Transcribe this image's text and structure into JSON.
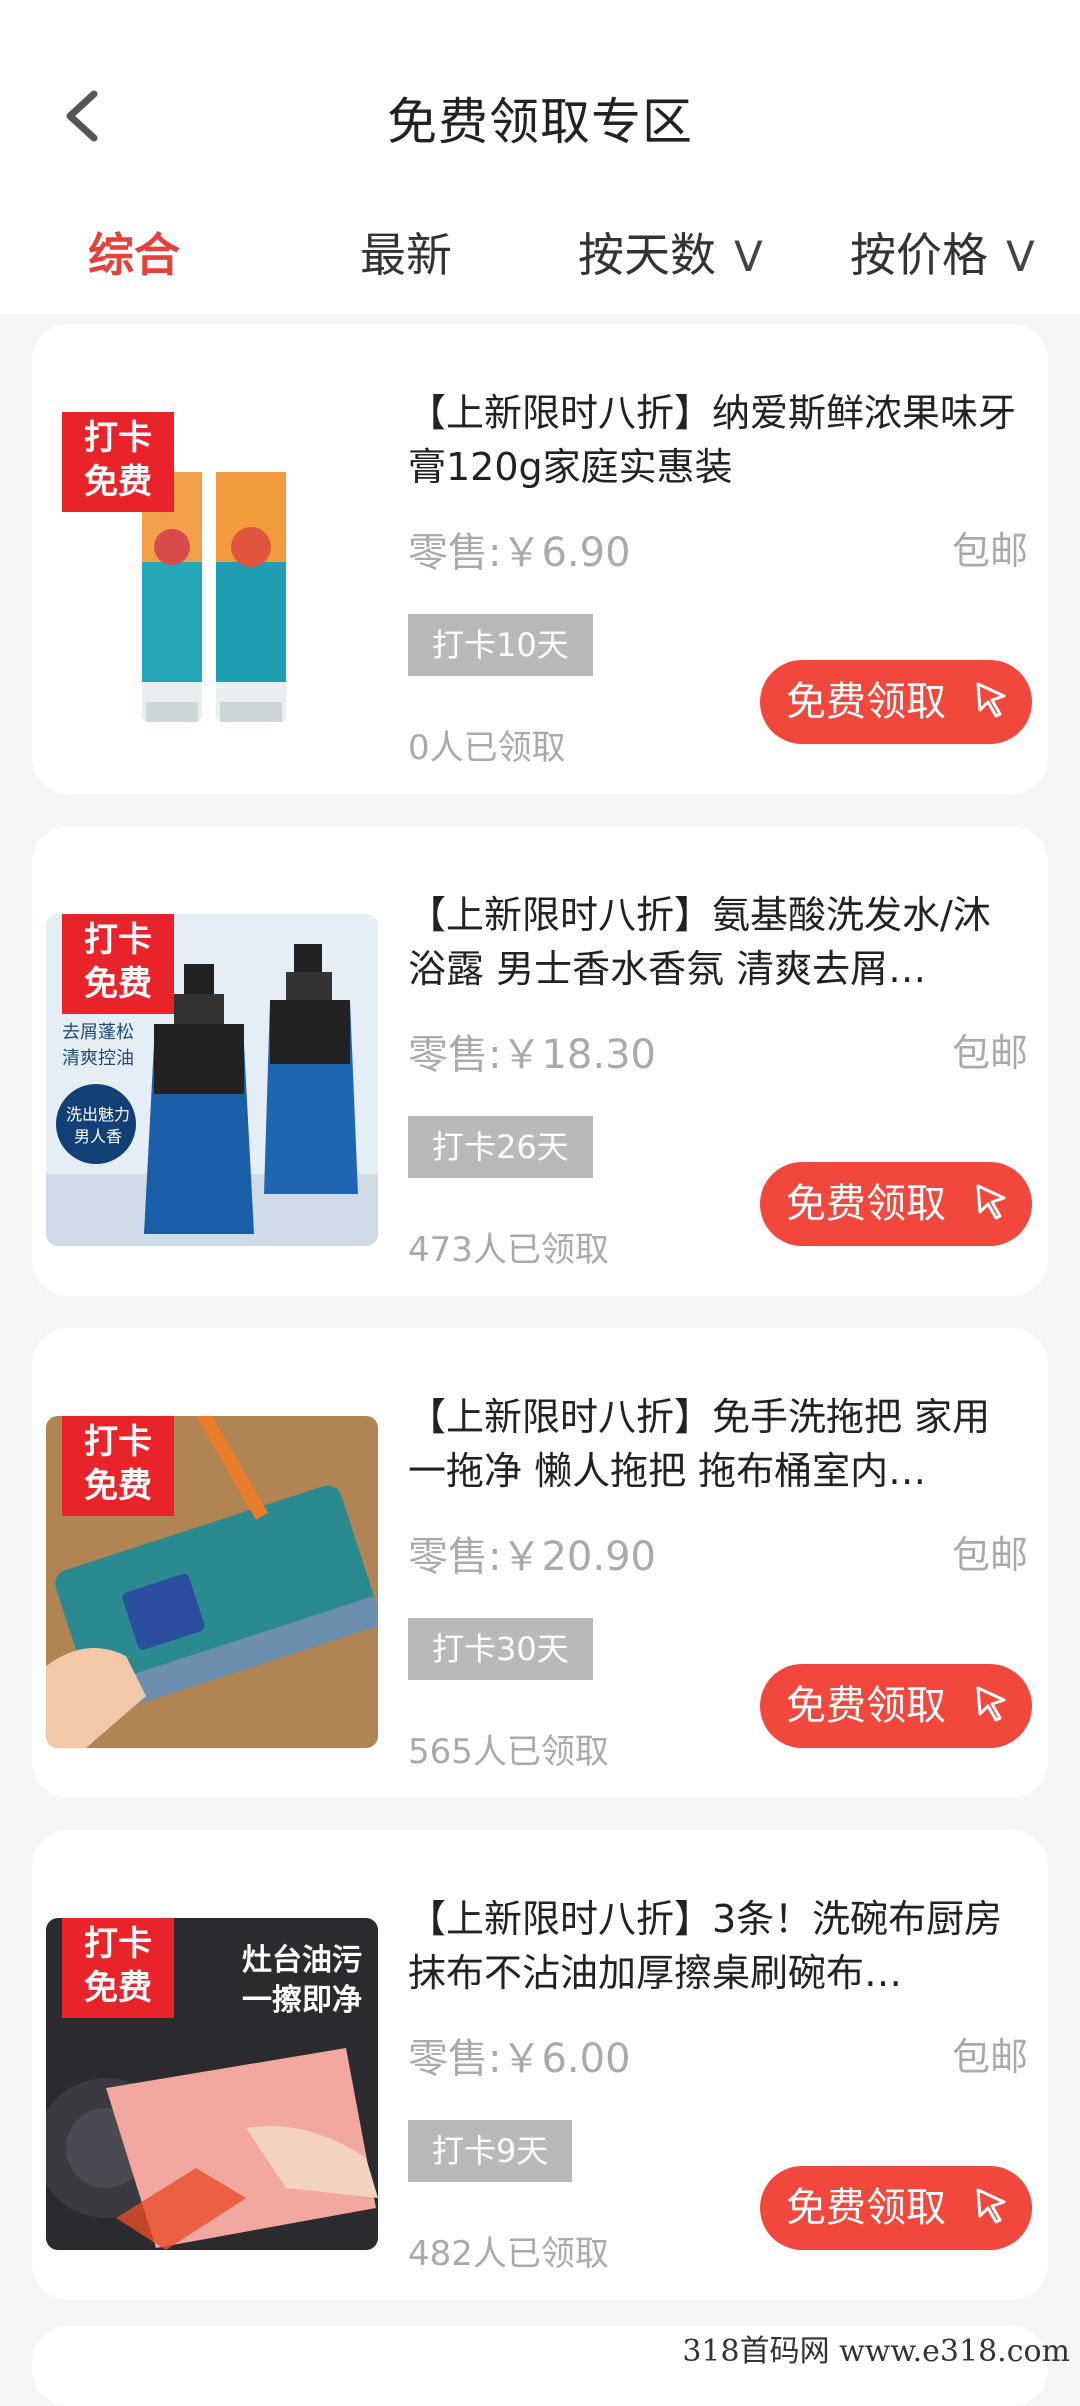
{
  "header": {
    "title": "免费领取专区",
    "back_icon": "chevron-left-icon"
  },
  "tabs": [
    {
      "label": "综合",
      "active": true
    },
    {
      "label": "最新",
      "active": false
    },
    {
      "label": "按天数",
      "dropdown": "V"
    },
    {
      "label": "按价格",
      "dropdown": "V"
    }
  ],
  "theme": {
    "accent": "#e5403b",
    "button": "#f2473c",
    "badge": "#e8242a"
  },
  "products": [
    {
      "badge": [
        "打卡",
        "免费"
      ],
      "title": "【上新限时八折】纳爱斯鲜浓果味牙膏120g家庭实惠装",
      "price": "零售:￥6.90",
      "shipping": "包邮",
      "days": "打卡10天",
      "claimed": "0人已领取",
      "button": "免费领取",
      "image": "toothpaste"
    },
    {
      "badge": [
        "打卡",
        "免费"
      ],
      "title": "【上新限时八折】氨基酸洗发水/沐浴露 男士香水香氛 清爽去屑…",
      "price": "零售:￥18.30",
      "shipping": "包邮",
      "days": "打卡26天",
      "claimed": "473人已领取",
      "button": "免费领取",
      "image": "shampoo",
      "image_text": [
        "去屑蓬松",
        "清爽控油",
        "洗出魅力",
        "男人香"
      ]
    },
    {
      "badge": [
        "打卡",
        "免费"
      ],
      "title": "【上新限时八折】免手洗拖把 家用一拖净 懒人拖把 拖布桶室内…",
      "price": "零售:￥20.90",
      "shipping": "包邮",
      "days": "打卡30天",
      "claimed": "565人已领取",
      "button": "免费领取",
      "image": "mop"
    },
    {
      "badge": [
        "打卡",
        "免费"
      ],
      "title": "【上新限时八折】3条！洗碗布厨房抹布不沾油加厚擦桌刷碗布…",
      "price": "零售:￥6.00",
      "shipping": "包邮",
      "days": "打卡9天",
      "claimed": "482人已领取",
      "button": "免费领取",
      "image": "dishcloth",
      "image_text": [
        "灶台油污",
        "一擦即净"
      ]
    }
  ],
  "watermark": "318首码网  www.e318.com"
}
